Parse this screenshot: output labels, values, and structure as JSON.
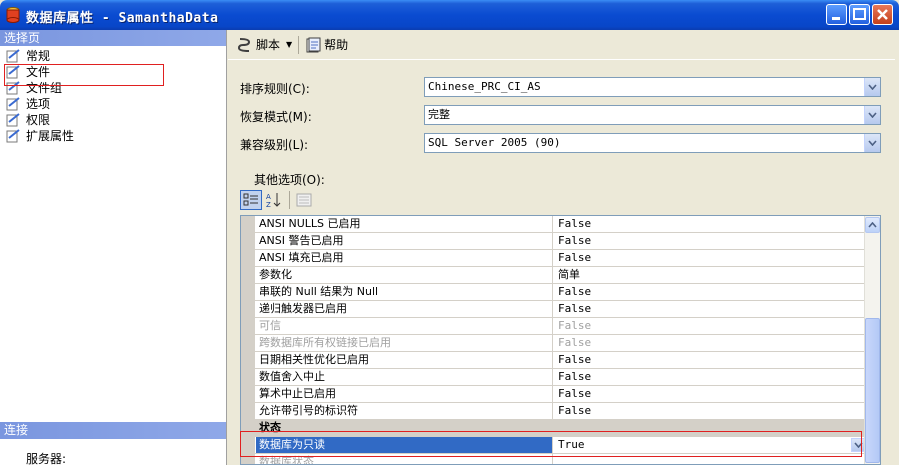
{
  "window": {
    "title": "数据库属性 - SamanthaData",
    "colors": {
      "titlebar": "#0a4bd1",
      "selection": "#316ac5",
      "highlight_box": "#e02020"
    }
  },
  "left_pane": {
    "header": "选择页",
    "items": [
      {
        "label": "常规",
        "icon": "page-icon"
      },
      {
        "label": "文件",
        "icon": "page-icon"
      },
      {
        "label": "文件组",
        "icon": "page-icon"
      },
      {
        "label": "选项",
        "icon": "page-icon",
        "highlighted": true
      },
      {
        "label": "权限",
        "icon": "page-icon"
      },
      {
        "label": "扩展属性",
        "icon": "page-icon"
      }
    ],
    "connection_header": "连接",
    "server_label": "服务器:"
  },
  "toolbar": {
    "script_label": "脚本",
    "help_label": "帮助"
  },
  "form": {
    "collation_label": "排序规则(C):",
    "collation_value": "Chinese_PRC_CI_AS",
    "recovery_label": "恢复模式(M):",
    "recovery_value": "完整",
    "compat_label": "兼容级别(L):",
    "compat_value": "SQL Server 2005 (90)",
    "other_label": "其他选项(O):"
  },
  "grid": {
    "rows": [
      {
        "name": "ANSI NULLS 已启用",
        "value": "False"
      },
      {
        "name": "ANSI 警告已启用",
        "value": "False"
      },
      {
        "name": "ANSI 填充已启用",
        "value": "False"
      },
      {
        "name": "参数化",
        "value": "简单"
      },
      {
        "name": "串联的 Null 结果为 Null",
        "value": "False"
      },
      {
        "name": "递归触发器已启用",
        "value": "False"
      },
      {
        "name": "可信",
        "value": "False",
        "disabled": true
      },
      {
        "name": "跨数据库所有权链接已启用",
        "value": "False",
        "disabled": true
      },
      {
        "name": "日期相关性优化已启用",
        "value": "False"
      },
      {
        "name": "数值舍入中止",
        "value": "False"
      },
      {
        "name": "算术中止已启用",
        "value": "False"
      },
      {
        "name": "允许带引号的标识符",
        "value": "False"
      }
    ],
    "category": {
      "toggle": "⊟",
      "name": "状态"
    },
    "selected_row": {
      "name": "数据库为只读",
      "value": "True"
    },
    "partial_row": {
      "name": "数据库状态",
      "value": ""
    }
  }
}
